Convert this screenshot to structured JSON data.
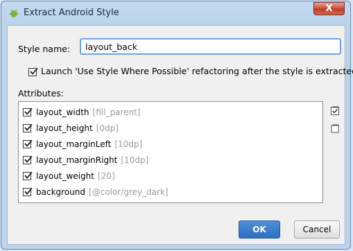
{
  "window": {
    "title": "Extract Android Style",
    "close_label": "X"
  },
  "style_name": {
    "label": "Style name:",
    "value": "layout_back"
  },
  "launch_option": {
    "label": "Launch 'Use Style Where Possible' refactoring after the style is extracted",
    "checked": true
  },
  "attributes": {
    "label": "Attributes:",
    "items": [
      {
        "name": "layout_width",
        "value": "[fill_parent]",
        "checked": true
      },
      {
        "name": "layout_height",
        "value": "[0dp]",
        "checked": true
      },
      {
        "name": "layout_marginLeft",
        "value": "[10dp]",
        "checked": true
      },
      {
        "name": "layout_marginRight",
        "value": "[10dp]",
        "checked": true
      },
      {
        "name": "layout_weight",
        "value": "[20]",
        "checked": true
      },
      {
        "name": "background",
        "value": "[@color/grey_dark]",
        "checked": true
      }
    ]
  },
  "side_icons": [
    "select-all-icon",
    "deselect-all-icon"
  ],
  "buttons": {
    "ok": "OK",
    "cancel": "Cancel"
  },
  "colors": {
    "primary_button": "#2c6fc0",
    "close_button": "#c9503c",
    "input_focus": "#6ba3e0"
  }
}
